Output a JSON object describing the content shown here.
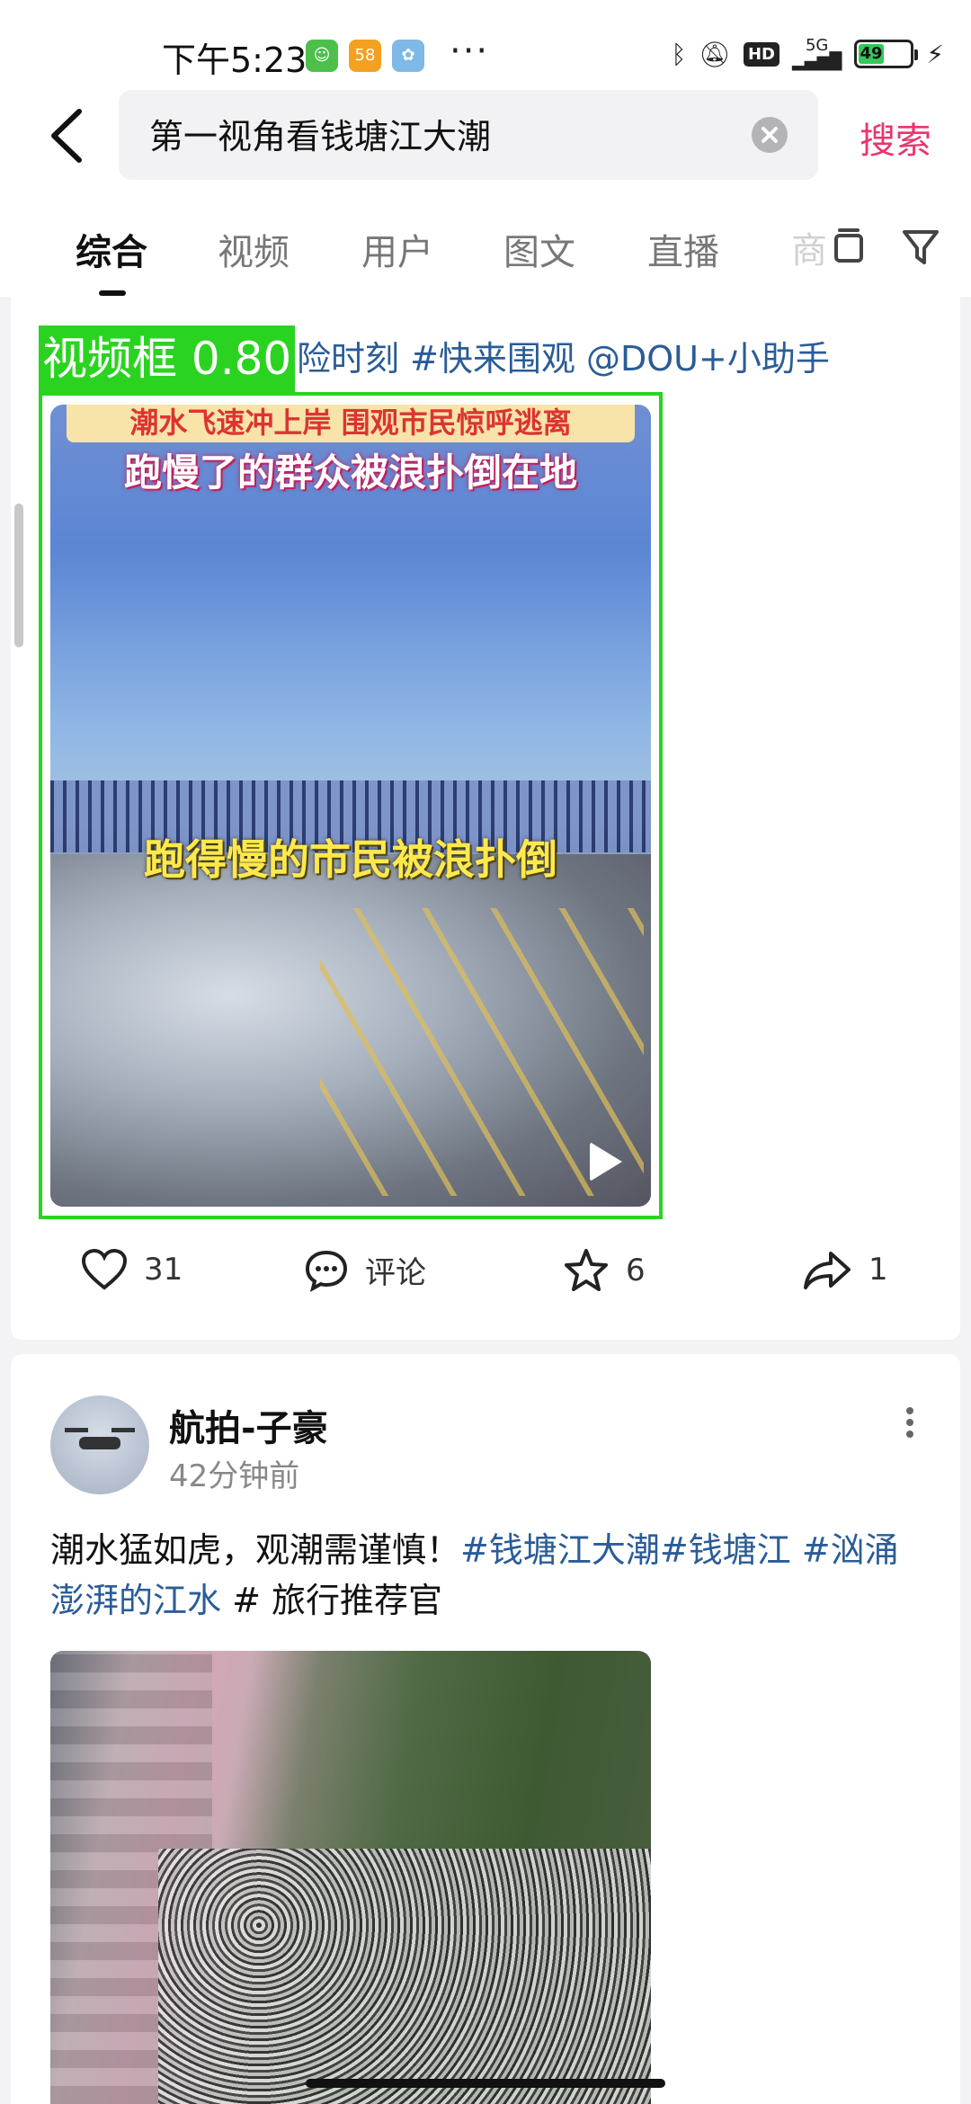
{
  "status_bar": {
    "time": "下午5:23",
    "battery": "49",
    "network": "5G",
    "hd": "HD",
    "dots": "···"
  },
  "search": {
    "query": "第一视角看钱塘江大潮",
    "submit_label": "搜索"
  },
  "tabs": [
    {
      "label": "综合",
      "active": true
    },
    {
      "label": "视频",
      "active": false
    },
    {
      "label": "用户",
      "active": false
    },
    {
      "label": "图文",
      "active": false
    },
    {
      "label": "直播",
      "active": false
    },
    {
      "label": "商",
      "active": false
    }
  ],
  "post1": {
    "hashtag_line": "险时刻  #快来围观 @DOU+小助手",
    "video": {
      "top_strip": "潮水飞速冲上岸 围观市民惊呼逃离",
      "caption_top": "跑慢了的群众被浪扑倒在地",
      "caption_mid": "跑得慢的市民被浪扑倒"
    },
    "detection_label": "视频框 0.80",
    "actions": {
      "likes": "31",
      "comment_label": "评论",
      "favorites": "6",
      "shares": "1"
    }
  },
  "post2": {
    "author": "航拍-子豪",
    "time": "42分钟前",
    "text_plain": "潮水猛如虎，观潮需谨慎！",
    "tags1": "#钱塘江大潮#钱塘江 #汹涌澎湃的江水",
    "tags2": "# 旅行推荐官"
  },
  "colors": {
    "accent": "#e8356d",
    "hashtag": "#2a5c97",
    "detection": "#2bd321"
  }
}
